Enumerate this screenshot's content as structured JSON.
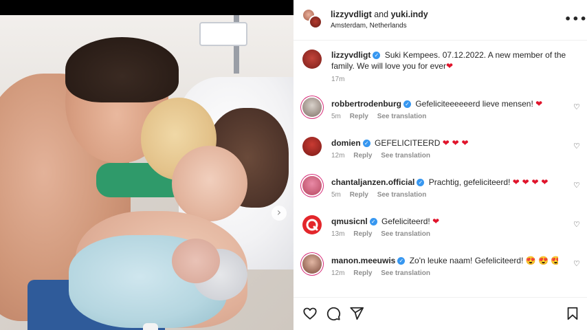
{
  "header": {
    "user1": "lizzyvdligt",
    "and_text": "and",
    "user2": "yuki.indy",
    "location": "Amsterdam, Netherlands",
    "more_icon": "more-horizontal-icon"
  },
  "caption": {
    "username": "lizzyvdligt",
    "text": "Suki Kempees. 07.12.2022. A new member of the family. We will love you for ever",
    "emoji": "❤",
    "time": "17m"
  },
  "comments": [
    {
      "username": "robbertrodenburg",
      "verified": true,
      "text": "Gefeliciteeeeeerd lieve mensen!",
      "emoji": "❤",
      "time": "5m",
      "reply": "Reply",
      "translate": "See translation"
    },
    {
      "username": "domien",
      "verified": true,
      "text": "GEFELICITEERD",
      "emoji": "❤ ❤ ❤",
      "time": "12m",
      "reply": "Reply",
      "translate": "See translation"
    },
    {
      "username": "chantaljanzen.official",
      "verified": true,
      "text": "Prachtig, gefeliciteerd!",
      "emoji": "❤ ❤ ❤ ❤",
      "time": "5m",
      "reply": "Reply",
      "translate": "See translation"
    },
    {
      "username": "qmusicnl",
      "verified": true,
      "text": "Gefeliciteerd!",
      "emoji": "❤",
      "time": "13m",
      "reply": "Reply",
      "translate": "See translation"
    },
    {
      "username": "manon.meeuwis",
      "verified": true,
      "text": "Zo'n leuke naam! Gefeliciteerd!",
      "emoji": "😍 😍 😍",
      "time": "12m",
      "reply": "Reply",
      "translate": "See translation"
    }
  ],
  "verified_mark": "✓",
  "like_icon": "♡",
  "footer": {
    "icons": [
      "heart-icon",
      "comment-icon",
      "share-icon",
      "bookmark-icon"
    ]
  },
  "colors": {
    "verified": "#3797f0",
    "heart": "#e0142b",
    "muted": "#8e8e8e",
    "text": "#262626"
  }
}
